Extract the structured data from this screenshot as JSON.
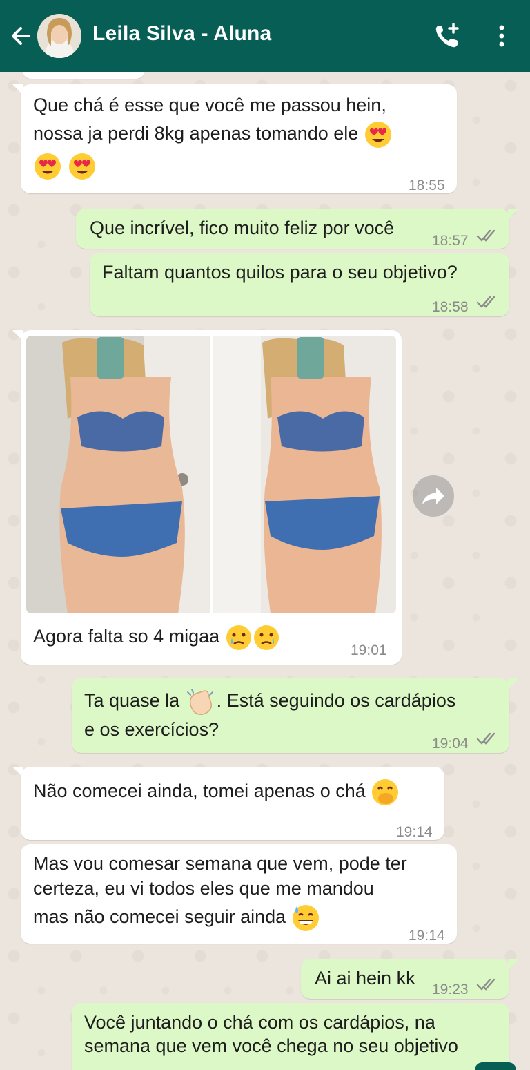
{
  "header": {
    "title": "Leila Silva - Aluna"
  },
  "messages": {
    "m1": {
      "line1": "Que chá é esse que você me passou hein,",
      "line2": "nossa ja perdi 8kg apenas tomando ele",
      "time": "18:55"
    },
    "m2": {
      "text": "Que incrível, fico muito feliz por você",
      "time": "18:57"
    },
    "m3": {
      "text": "Faltam quantos quilos para o seu objetivo?",
      "time": "18:58"
    },
    "m4": {
      "caption": "Agora falta so 4 migaa",
      "time": "19:01"
    },
    "m5": {
      "line1a": "Ta quase la",
      "line1b": ". Está seguindo os cardápios",
      "line2": "e os exercícios?",
      "time": "19:04"
    },
    "m6": {
      "text": "Não comecei ainda, tomei apenas o chá",
      "time": "19:14"
    },
    "m7": {
      "line1": "Mas vou comesar semana que vem, pode ter",
      "line2": "certeza, eu vi todos eles que me mandou",
      "line3": "mas não comecei seguir ainda",
      "time": "19:14"
    },
    "m8": {
      "text": "Ai ai hein kk",
      "time": "19:23"
    },
    "m9": {
      "line1": "Você juntando o chá com os cardápios, na",
      "line2": "semana que vem você chega no seu objetivo"
    }
  },
  "colors": {
    "header": "#075e54",
    "incoming": "#ffffff",
    "outgoing": "#dcf8c6",
    "read_ticks": "#8b8b8b"
  }
}
